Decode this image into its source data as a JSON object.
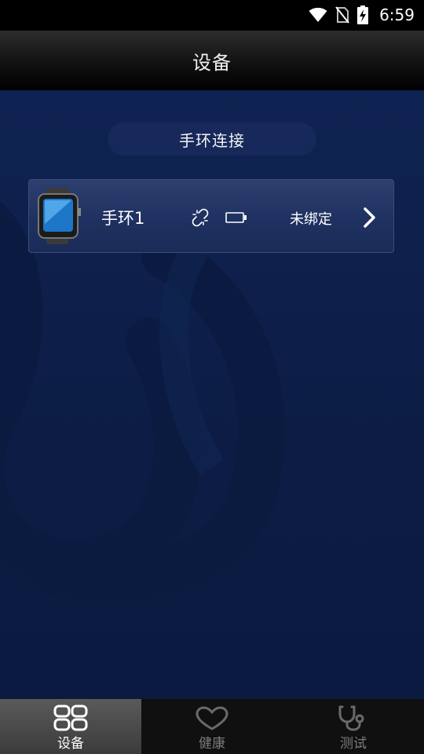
{
  "status_bar": {
    "time": "6:59",
    "icons": [
      "wifi-icon",
      "no-sim-icon",
      "battery-charging-icon"
    ]
  },
  "header": {
    "title": "设备"
  },
  "connect_button": {
    "label": "手环连接"
  },
  "device": {
    "name": "手环1",
    "bind_status": "未绑定",
    "icons": [
      "watch-icon",
      "link-broken-icon",
      "battery-empty-icon",
      "chevron-right-icon"
    ]
  },
  "tabs": [
    {
      "label": "设备",
      "icon": "grid-icon",
      "active": true
    },
    {
      "label": "健康",
      "icon": "heart-icon",
      "active": false
    },
    {
      "label": "测试",
      "icon": "stethoscope-icon",
      "active": false
    }
  ],
  "colors": {
    "background": "#0d1e45",
    "card": "#22345f",
    "tab_active": "#4a4a4a"
  }
}
